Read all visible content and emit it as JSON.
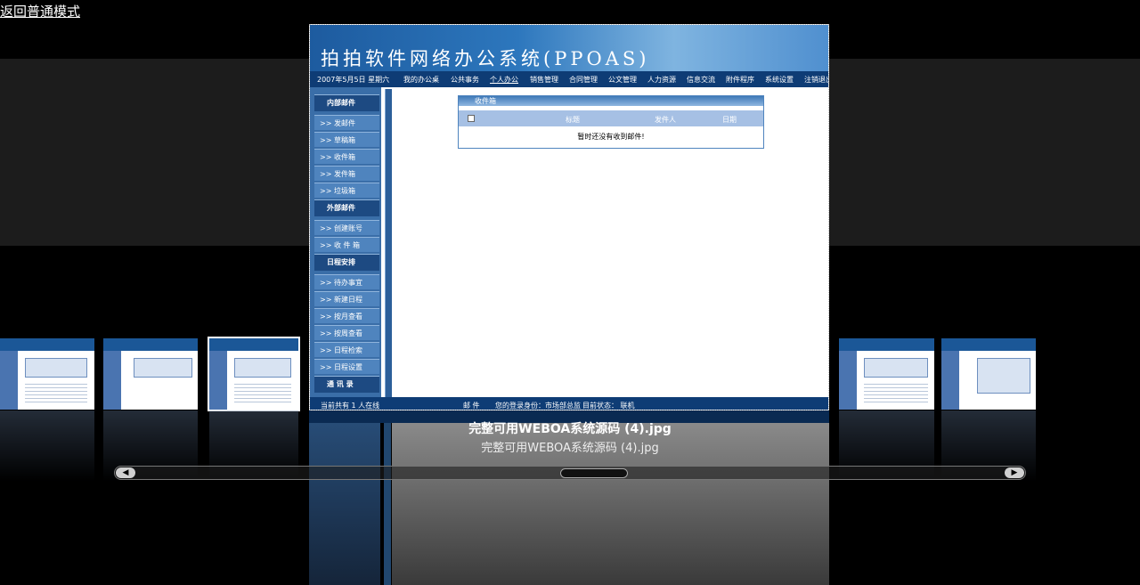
{
  "back_link": "返回普通模式",
  "viewer": {
    "caption": "完整可用WEBOA系统源码 (4).jpg",
    "subcaption": "完整可用WEBOA系统源码 (4).jpg"
  },
  "screenshot": {
    "title": "拍拍软件网络办公系统(PPOAS)",
    "nav": [
      "我的办公桌",
      "公共事务",
      "个人办公",
      "销售管理",
      "合同管理",
      "公文管理",
      "人力资源",
      "信息交流",
      "附件程序",
      "系统设置",
      "注销退出"
    ],
    "date": "2007年5月5日 星期六",
    "sidebar": [
      {
        "label": "内部邮件",
        "group": true
      },
      {
        "label": ">> 发邮件"
      },
      {
        "label": ">> 草稿箱"
      },
      {
        "label": ">> 收件箱"
      },
      {
        "label": ">> 发件箱"
      },
      {
        "label": ">> 垃圾箱"
      },
      {
        "label": "外部邮件",
        "group": true
      },
      {
        "label": ">> 创建账号"
      },
      {
        "label": ">> 收 件 箱"
      },
      {
        "label": "日程安排",
        "group": true
      },
      {
        "label": ">> 待办事宜"
      },
      {
        "label": ">> 新建日程"
      },
      {
        "label": ">> 按月查看"
      },
      {
        "label": ">> 按周查看"
      },
      {
        "label": ">> 日程检索"
      },
      {
        "label": ">> 日程设置"
      },
      {
        "label": "通 讯 录",
        "group": true
      }
    ],
    "inbox": {
      "title": "收件箱",
      "col_title": "标题",
      "col_sender": "发件人",
      "col_date": "日期",
      "empty_text": "暂时还没有收到邮件!"
    },
    "status": {
      "online": "当前共有  1  人在线",
      "mail": "邮 件",
      "identity": "您的登录身份：市场部总监",
      "state": "目前状态：  联机"
    }
  }
}
